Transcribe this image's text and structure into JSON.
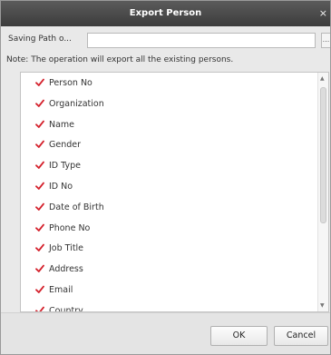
{
  "dialog": {
    "title": "Export Person",
    "close_glyph": "×"
  },
  "path": {
    "label": "Saving Path o...",
    "value": "",
    "browse_label": "..."
  },
  "note": "Note: The operation will export all the existing persons.",
  "fields": [
    {
      "label": "Person No",
      "checked": true
    },
    {
      "label": "Organization",
      "checked": true
    },
    {
      "label": "Name",
      "checked": true
    },
    {
      "label": "Gender",
      "checked": true
    },
    {
      "label": "ID Type",
      "checked": true
    },
    {
      "label": "ID No",
      "checked": true
    },
    {
      "label": "Date of Birth",
      "checked": true
    },
    {
      "label": "Phone No",
      "checked": true
    },
    {
      "label": "Job Title",
      "checked": true
    },
    {
      "label": "Address",
      "checked": true
    },
    {
      "label": "Email",
      "checked": true
    },
    {
      "label": "Country",
      "checked": true
    }
  ],
  "scrollbar": {
    "up_glyph": "▲",
    "down_glyph": "▼"
  },
  "buttons": {
    "ok": "OK",
    "cancel": "Cancel"
  },
  "colors": {
    "check_mark": "#d4202b",
    "title_bar": "#4a4a4a"
  }
}
